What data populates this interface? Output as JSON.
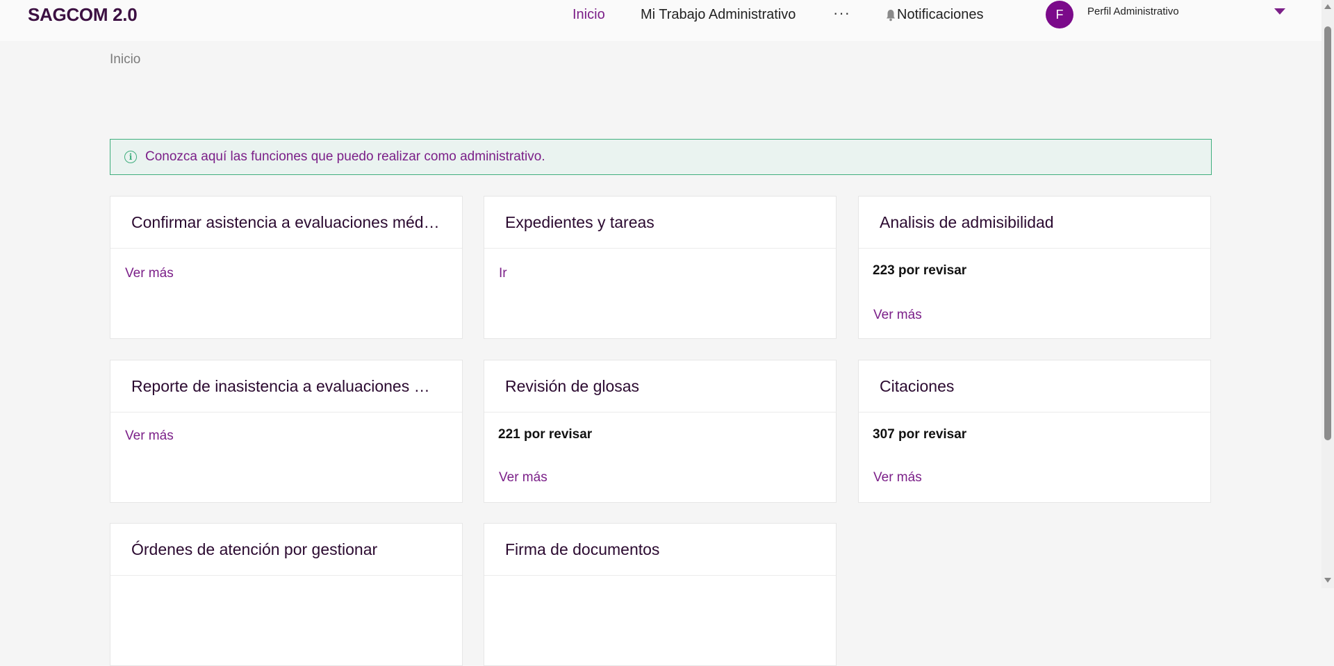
{
  "app": {
    "title": "SAGCOM 2.0"
  },
  "nav": {
    "inicio": "Inicio",
    "trabajo": "Mi Trabajo Administrativo",
    "more": "···",
    "notificaciones": "Notificaciones"
  },
  "profile": {
    "initial": "F",
    "label": "Perfil Administrativo"
  },
  "breadcrumb": "Inicio",
  "banner": {
    "text": "Conozca aquí las funciones que puedo realizar como administrativo.",
    "icon": "i"
  },
  "cards": [
    {
      "title": "Confirmar asistencia a evaluaciones médicas",
      "count": "",
      "link": "Ver más"
    },
    {
      "title": "Expedientes y tareas",
      "count": "",
      "link": "Ir"
    },
    {
      "title": "Analisis de admisibilidad",
      "count": "223 por revisar",
      "link": "Ver más"
    },
    {
      "title": "Reporte de inasistencia a evaluaciones médicas",
      "count": "",
      "link": "Ver más"
    },
    {
      "title": "Revisión de glosas",
      "count": "221 por revisar",
      "link": "Ver más"
    },
    {
      "title": "Citaciones",
      "count": "307 por revisar",
      "link": "Ver más"
    },
    {
      "title": "Órdenes de atención por gestionar",
      "count": "",
      "link": ""
    },
    {
      "title": "Firma de documentos",
      "count": "",
      "link": ""
    }
  ],
  "colors": {
    "accent": "#7b1f88",
    "brand": "#3c1042",
    "banner_border": "#3fae7d"
  }
}
